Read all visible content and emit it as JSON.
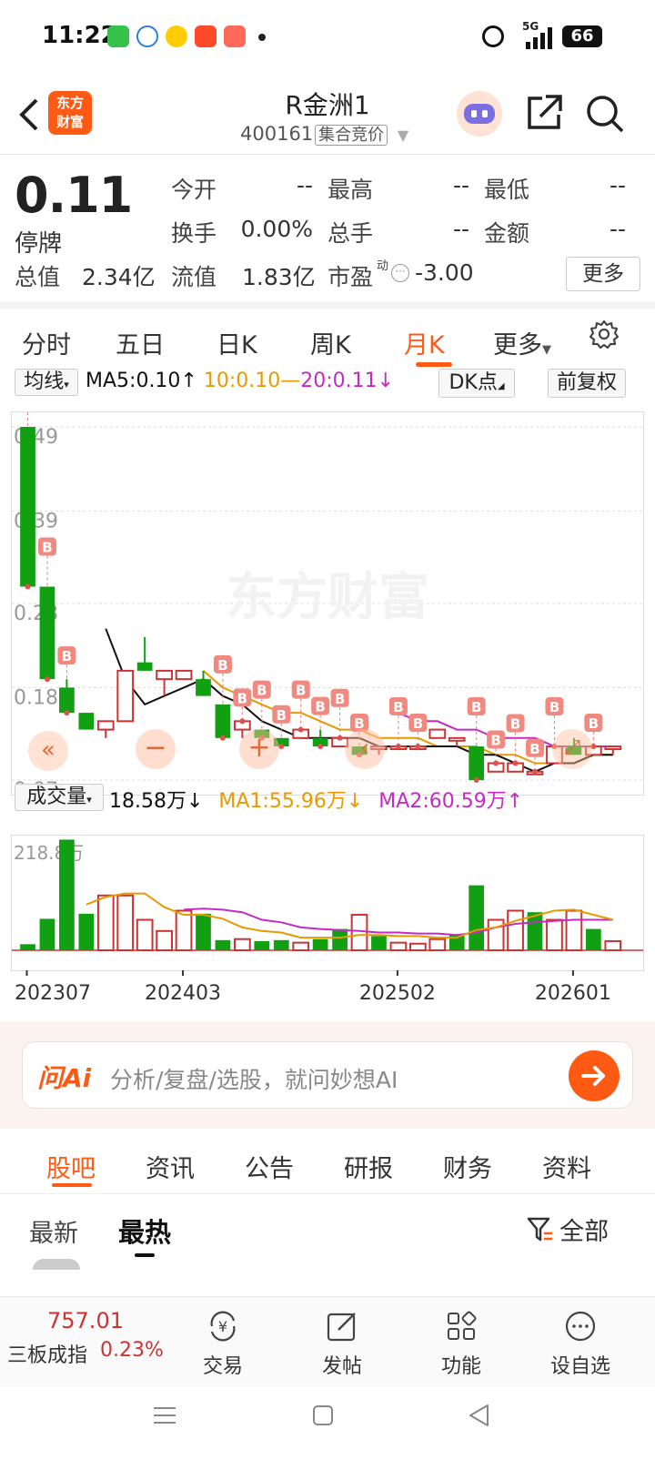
{
  "status_bar": {
    "time": "11:22",
    "network": "5G",
    "battery": "66",
    "icons": [
      "phone-icon",
      "at-icon",
      "app-icon",
      "app-icon",
      "oppo-icon",
      "dot-icon",
      "alarm-icon",
      "signal-icon",
      "battery-icon"
    ]
  },
  "header": {
    "logo_line1": "东方",
    "logo_line2": "财富",
    "title": "R金洲1",
    "code": "400161",
    "board": "集合竞价"
  },
  "quote": {
    "price": "0.11",
    "status": "停牌",
    "rows": [
      [
        {
          "label": "今开",
          "value": "--"
        },
        {
          "label": "最高",
          "value": "--"
        },
        {
          "label": "最低",
          "value": "--"
        }
      ],
      [
        {
          "label": "换手",
          "value": "0.00%"
        },
        {
          "label": "总手",
          "value": "--"
        },
        {
          "label": "金额",
          "value": "--"
        }
      ]
    ],
    "total_value_label": "总值",
    "total_value": "2.34亿",
    "float_value_label": "流值",
    "float_value": "1.83亿",
    "pe_label": "市盈",
    "pe_sup": "动",
    "pe_value": "-3.00",
    "more": "更多"
  },
  "period_tabs": {
    "items": [
      "分时",
      "五日",
      "日K",
      "周K",
      "月K",
      "更多"
    ],
    "active": "月K"
  },
  "kline_legend": {
    "indicator": "均线",
    "ma5": "MA5:0.10",
    "ma10": "10:0.10",
    "ma20_sep": "—",
    "ma20": "20:0.11",
    "dk_button": "DK点",
    "adjust_button": "前复权"
  },
  "volume_legend": {
    "indicator": "成交量",
    "current": "18.58万",
    "ma1": "MA1:55.96万",
    "ma2": "MA2:60.59万"
  },
  "chart_data": [
    {
      "type": "candlestick",
      "y_ticks": [
        "0.49",
        "0.39",
        "0.28",
        "0.18",
        "0.07"
      ],
      "ylim": [
        0.07,
        0.49
      ],
      "up_color": "#cc3333",
      "down_color": "#11a011",
      "candles": [
        {
          "o": 0.49,
          "h": 0.49,
          "l": 0.3,
          "c": 0.3
        },
        {
          "o": 0.3,
          "h": 0.3,
          "l": 0.19,
          "c": 0.19
        },
        {
          "o": 0.18,
          "h": 0.19,
          "l": 0.15,
          "c": 0.15
        },
        {
          "o": 0.15,
          "h": 0.15,
          "l": 0.13,
          "c": 0.13
        },
        {
          "o": 0.13,
          "h": 0.14,
          "l": 0.12,
          "c": 0.14
        },
        {
          "o": 0.14,
          "h": 0.2,
          "l": 0.14,
          "c": 0.2
        },
        {
          "o": 0.21,
          "h": 0.24,
          "l": 0.2,
          "c": 0.2
        },
        {
          "o": 0.19,
          "h": 0.2,
          "l": 0.17,
          "c": 0.2
        },
        {
          "o": 0.19,
          "h": 0.2,
          "l": 0.19,
          "c": 0.2
        },
        {
          "o": 0.19,
          "h": 0.2,
          "l": 0.17,
          "c": 0.17
        },
        {
          "o": 0.16,
          "h": 0.16,
          "l": 0.12,
          "c": 0.12
        },
        {
          "o": 0.13,
          "h": 0.14,
          "l": 0.12,
          "c": 0.14
        },
        {
          "o": 0.13,
          "h": 0.13,
          "l": 0.12,
          "c": 0.12
        },
        {
          "o": 0.12,
          "h": 0.12,
          "l": 0.11,
          "c": 0.11
        },
        {
          "o": 0.12,
          "h": 0.13,
          "l": 0.12,
          "c": 0.13
        },
        {
          "o": 0.12,
          "h": 0.13,
          "l": 0.11,
          "c": 0.11
        },
        {
          "o": 0.11,
          "h": 0.12,
          "l": 0.11,
          "c": 0.12
        },
        {
          "o": 0.11,
          "h": 0.11,
          "l": 0.1,
          "c": 0.1
        },
        {
          "o": 0.11,
          "h": 0.11,
          "l": 0.1,
          "c": 0.11
        },
        {
          "o": 0.11,
          "h": 0.11,
          "l": 0.11,
          "c": 0.11
        },
        {
          "o": 0.11,
          "h": 0.11,
          "l": 0.11,
          "c": 0.11
        },
        {
          "o": 0.12,
          "h": 0.13,
          "l": 0.12,
          "c": 0.13
        },
        {
          "o": 0.12,
          "h": 0.12,
          "l": 0.11,
          "c": 0.12
        },
        {
          "o": 0.11,
          "h": 0.11,
          "l": 0.07,
          "c": 0.07
        },
        {
          "o": 0.08,
          "h": 0.09,
          "l": 0.08,
          "c": 0.09
        },
        {
          "o": 0.08,
          "h": 0.09,
          "l": 0.08,
          "c": 0.09
        },
        {
          "o": 0.08,
          "h": 0.08,
          "l": 0.08,
          "c": 0.08
        },
        {
          "o": 0.09,
          "h": 0.11,
          "l": 0.09,
          "c": 0.11
        },
        {
          "o": 0.11,
          "h": 0.12,
          "l": 0.1,
          "c": 0.1
        },
        {
          "o": 0.1,
          "h": 0.11,
          "l": 0.1,
          "c": 0.11
        },
        {
          "o": 0.11,
          "h": 0.11,
          "l": 0.1,
          "c": 0.11
        }
      ],
      "ma5": [
        null,
        null,
        null,
        null,
        0.25,
        0.19,
        0.16,
        0.17,
        0.18,
        0.19,
        0.17,
        0.16,
        0.14,
        0.13,
        0.12,
        0.12,
        0.12,
        0.12,
        0.11,
        0.11,
        0.11,
        0.11,
        0.11,
        0.1,
        0.1,
        0.09,
        0.08,
        0.09,
        0.09,
        0.1,
        0.1
      ],
      "ma10": [
        null,
        null,
        null,
        null,
        null,
        null,
        null,
        null,
        null,
        0.2,
        0.18,
        0.17,
        0.16,
        0.15,
        0.15,
        0.14,
        0.13,
        0.13,
        0.12,
        0.12,
        0.12,
        0.11,
        0.11,
        0.11,
        0.1,
        0.1,
        0.09,
        0.09,
        0.09,
        0.1,
        0.1
      ],
      "ma20": [
        null,
        null,
        null,
        null,
        null,
        null,
        null,
        null,
        null,
        null,
        null,
        null,
        null,
        null,
        null,
        null,
        null,
        null,
        null,
        0.15,
        0.14,
        0.14,
        0.13,
        0.13,
        0.12,
        0.12,
        0.12,
        0.11,
        0.11,
        0.11,
        0.11
      ],
      "b_markers": [
        0,
        1,
        2,
        10,
        11,
        12,
        13,
        14,
        15,
        16,
        17,
        19,
        20,
        23,
        24,
        25,
        26,
        27,
        29
      ],
      "watermark": "东方财富"
    },
    {
      "type": "bar",
      "y_ticks": [
        "218.8万"
      ],
      "ylim": [
        0,
        218.8
      ],
      "x_tick_labels": [
        "202307",
        "202403",
        "202502",
        "202601"
      ],
      "x_tick_index": [
        0,
        8,
        19,
        28
      ],
      "values": [
        12,
        62,
        218,
        72,
        108,
        108,
        60,
        38,
        78,
        72,
        20,
        22,
        18,
        20,
        15,
        22,
        42,
        70,
        28,
        15,
        13,
        22,
        32,
        128,
        60,
        78,
        75,
        60,
        78,
        42,
        18
      ],
      "up": [
        false,
        false,
        false,
        false,
        true,
        true,
        true,
        true,
        true,
        false,
        false,
        true,
        false,
        false,
        true,
        false,
        false,
        true,
        false,
        true,
        true,
        true,
        false,
        false,
        true,
        true,
        false,
        true,
        true,
        false,
        true
      ],
      "ma1": [
        null,
        null,
        null,
        90,
        105,
        112,
        112,
        85,
        70,
        70,
        62,
        45,
        38,
        35,
        25,
        25,
        25,
        30,
        30,
        28,
        28,
        25,
        25,
        40,
        45,
        58,
        68,
        78,
        80,
        70,
        60
      ],
      "ma2": [
        null,
        null,
        null,
        null,
        null,
        null,
        null,
        null,
        80,
        82,
        80,
        75,
        60,
        55,
        45,
        42,
        40,
        38,
        35,
        35,
        33,
        33,
        30,
        35,
        45,
        52,
        55,
        58,
        60,
        60,
        60
      ],
      "up_color": "#cc3333",
      "down_color": "#11a011"
    }
  ],
  "ai_input": {
    "logo": "问Ai",
    "placeholder": "分析/复盘/选股，就问妙想AI"
  },
  "section_tabs": {
    "items": [
      "股吧",
      "资讯",
      "公告",
      "研报",
      "财务",
      "资料"
    ],
    "active": "股吧"
  },
  "sub_tabs": {
    "latest": "最新",
    "hot": "最热",
    "filter": "全部"
  },
  "bottom_bar": {
    "index_value": "757.01",
    "index_name": "三板成指",
    "index_change": "0.23%",
    "items": [
      "交易",
      "发帖",
      "功能",
      "设自选"
    ]
  },
  "colors": {
    "accent": "#ff5a14",
    "up": "#cc3333",
    "down": "#11a011",
    "ma_black": "#111111",
    "ma_orange": "#e69a00",
    "ma_purple": "#c42bc4"
  }
}
